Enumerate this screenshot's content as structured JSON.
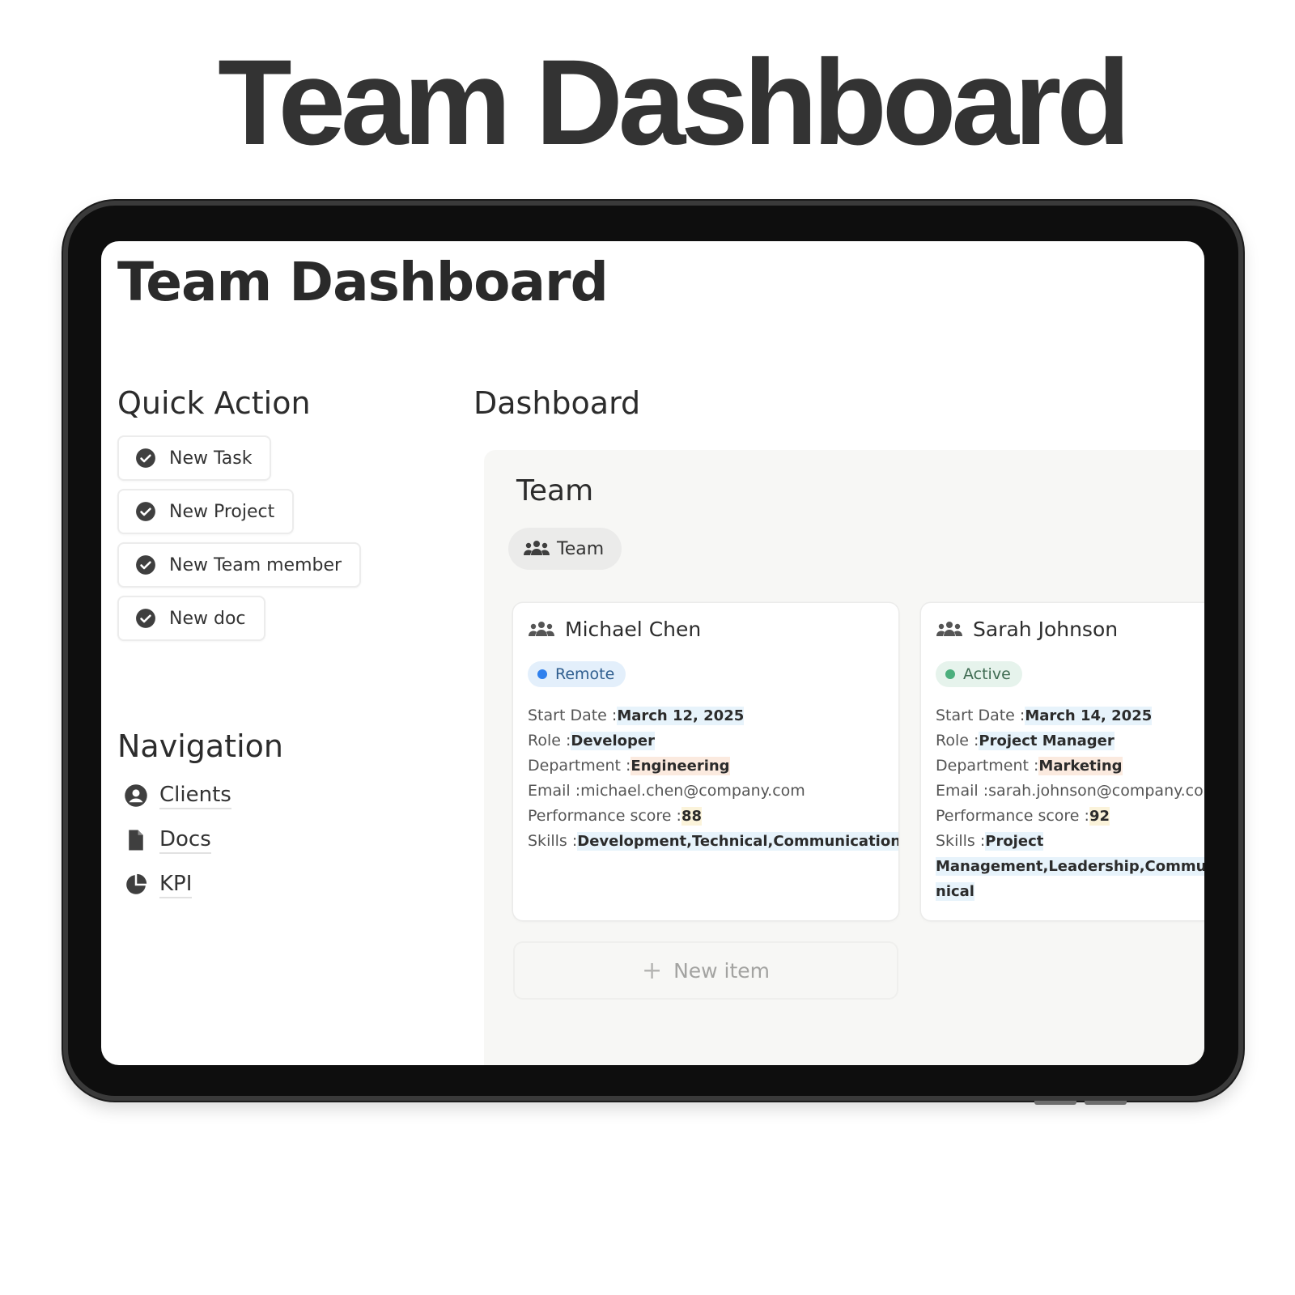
{
  "hero": {
    "title": "Team Dashboard"
  },
  "page": {
    "title": "Team Dashboard"
  },
  "quick_action": {
    "heading": "Quick Action",
    "buttons": [
      {
        "label": "New Task",
        "icon": "check-circle-icon"
      },
      {
        "label": "New Project",
        "icon": "check-circle-icon"
      },
      {
        "label": "New Team member",
        "icon": "check-circle-icon"
      },
      {
        "label": "New doc",
        "icon": "check-circle-icon"
      }
    ]
  },
  "navigation": {
    "heading": "Navigation",
    "items": [
      {
        "label": "Clients",
        "icon": "user-circle-icon"
      },
      {
        "label": "Docs",
        "icon": "document-icon"
      },
      {
        "label": "KPI",
        "icon": "pie-chart-icon"
      }
    ]
  },
  "dashboard": {
    "heading": "Dashboard",
    "team_title": "Team",
    "tab_label": "Team",
    "new_item_label": "New item",
    "new_item_plus": "+",
    "cards": [
      {
        "name": "Michael Chen",
        "status": "Remote",
        "status_color": "#2f80ed",
        "status_bg": "#e3effb",
        "start_date_label": "Start Date :",
        "start_date": "March 12, 2025",
        "role_label": "Role :",
        "role": "Developer",
        "department_label": "Department :",
        "department": "Engineering",
        "email_label": "Email :",
        "email": "michael.chen@company.com",
        "performance_label": "Performance score :",
        "performance": "88",
        "skills_label": "Skills :",
        "skills": "Development,Technical,Communication"
      },
      {
        "name": "Sarah Johnson",
        "status": "Active",
        "status_color": "#4caf7d",
        "status_bg": "#e6f3ec",
        "start_date_label": "Start Date :",
        "start_date": "March 14, 2025",
        "role_label": "Role :",
        "role": "Project Manager",
        "department_label": "Department :",
        "department": "Marketing",
        "email_label": "Email :",
        "email": "sarah.johnson@company.co",
        "performance_label": "Performance score :",
        "performance": "92",
        "skills_label": "Skills :",
        "skills_line1": "Project",
        "skills_line2": "Management,Leadership,Commu",
        "skills_line3": "nical"
      }
    ]
  },
  "colors": {
    "panel_bg": "#f7f7f5",
    "tag_blue": "#e7f3fb",
    "tag_orange": "#fbeadf",
    "tag_yellow": "#fbf3da"
  }
}
